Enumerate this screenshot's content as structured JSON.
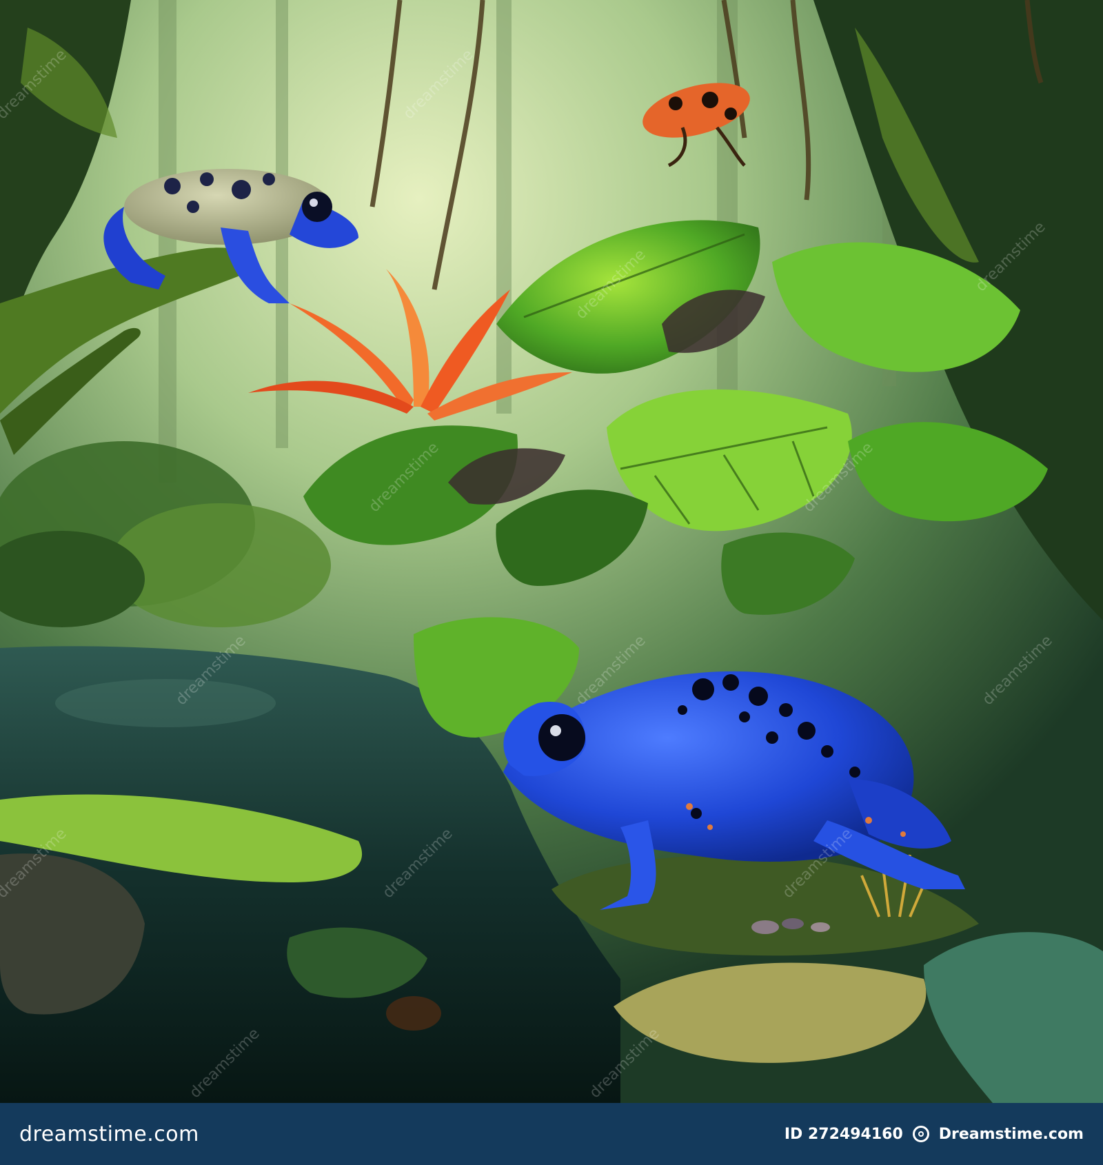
{
  "watermark": {
    "text": "dreamstime",
    "logo": "dreamstime-spiral-logo"
  },
  "footer": {
    "site": "dreamstime.com",
    "id_label": "ID 272494160",
    "brand": "Dreamstime.com"
  },
  "scene": {
    "subject": "blue poison dart frogs in a rainforest pond",
    "colors": {
      "frog_blue": "#1f47d6",
      "leaf_green": "#5fbf2a",
      "flower_orange": "#f26a2a",
      "water_dark": "#0e2422",
      "mist": "#b9d59a"
    }
  }
}
